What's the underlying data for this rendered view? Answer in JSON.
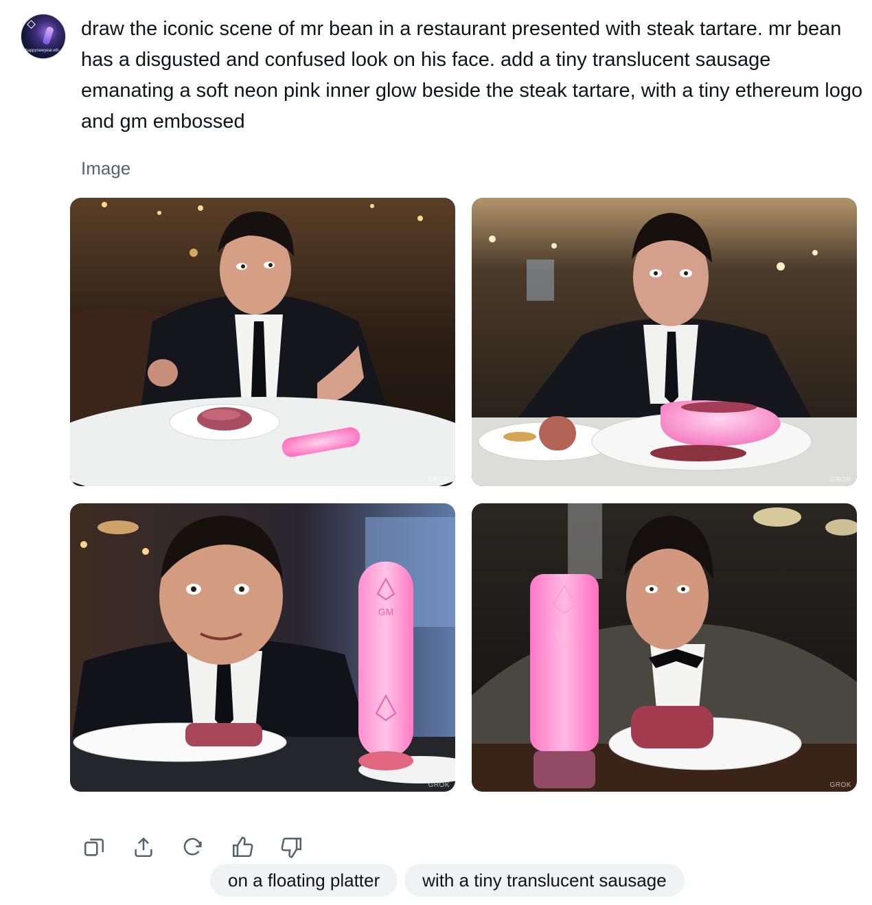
{
  "post": {
    "avatar_icon": "user-avatar",
    "avatar_caption": "happynewyear.eth",
    "prompt": "draw the iconic scene of mr bean in a restaurant presented with steak tartare. mr bean has a disgusted and confused look on his face. add a tiny translucent sausage emanating a soft neon pink inner glow beside the steak tartare, with a tiny ethereum logo and gm embossed"
  },
  "gallery": {
    "label": "Image",
    "watermark": "GROK",
    "images": [
      {
        "alt": "Mr Bean at restaurant table with steak tartare and glowing pink sausage",
        "bottle_text": ""
      },
      {
        "alt": "Mr Bean with sausage on side plate and pink bowl of tartare",
        "bottle_text": ""
      },
      {
        "alt": "Mr Bean smiling beside upright pink glowing sausage embossed with ethereum logo",
        "bottle_text": "GM"
      },
      {
        "alt": "Mr Bean in bow tie beside glowing pink cylinder with ethereum logo",
        "bottle_text": "GM"
      }
    ]
  },
  "actions": [
    {
      "name": "copy-icon",
      "label": "Copy"
    },
    {
      "name": "share-icon",
      "label": "Share"
    },
    {
      "name": "regenerate-icon",
      "label": "Regenerate"
    },
    {
      "name": "thumbs-up-icon",
      "label": "Like"
    },
    {
      "name": "thumbs-down-icon",
      "label": "Dislike"
    }
  ],
  "suggestions": [
    "on a floating platter",
    "with a tiny translucent sausage"
  ],
  "colors": {
    "text": "#0f1419",
    "secondary": "#536471",
    "chip_bg": "#eff3f4",
    "neon_pink": "#ff7fc8"
  }
}
